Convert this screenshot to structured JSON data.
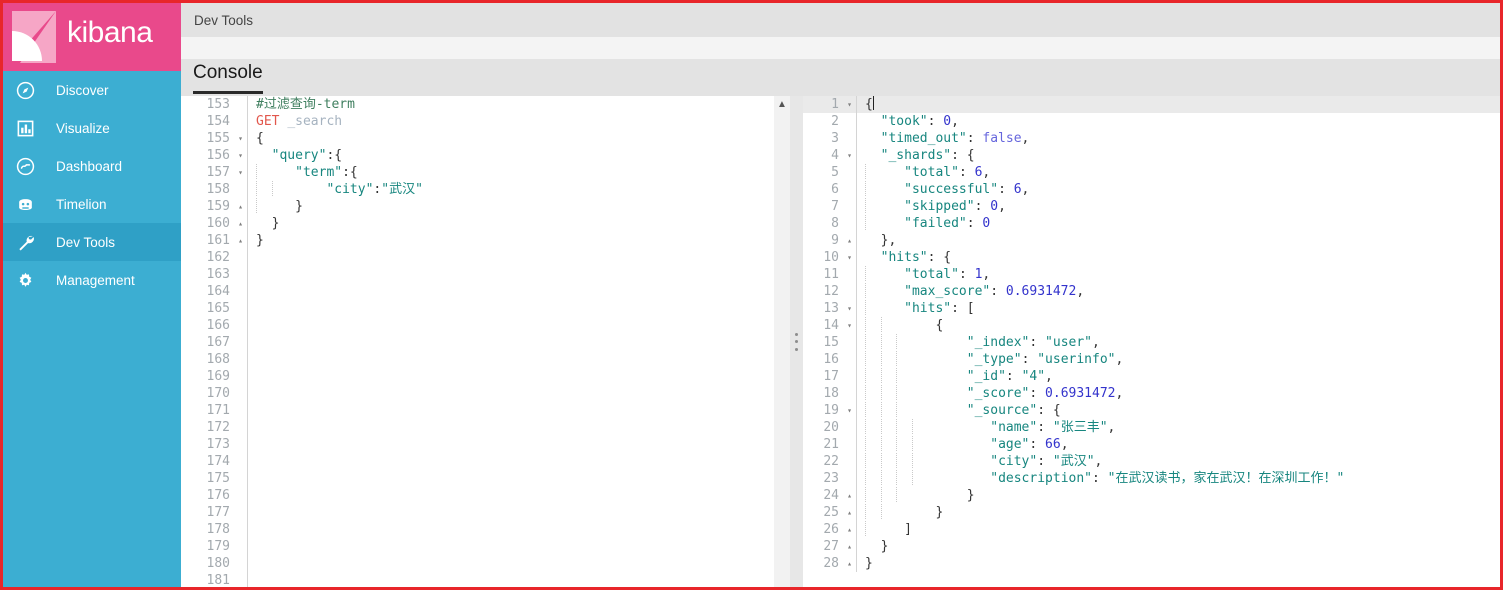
{
  "app": {
    "name": "kibana",
    "brand_color": "#e9498b",
    "sidebar_color": "#3caed2",
    "sidebar_active_color": "#2fa0c6",
    "frame_border_color": "#e8262a"
  },
  "sidebar": {
    "logo_label": "kibana",
    "items": [
      {
        "label": "Discover",
        "icon": "compass-icon",
        "active": false
      },
      {
        "label": "Visualize",
        "icon": "bar-chart-icon",
        "active": false
      },
      {
        "label": "Dashboard",
        "icon": "dashboard-icon",
        "active": false
      },
      {
        "label": "Timelion",
        "icon": "timelion-icon",
        "active": false
      },
      {
        "label": "Dev Tools",
        "icon": "wrench-icon",
        "active": true
      },
      {
        "label": "Management",
        "icon": "gear-icon",
        "active": false
      }
    ]
  },
  "header": {
    "breadcrumb": "Dev Tools"
  },
  "tabs": {
    "console_label": "Console"
  },
  "editor": {
    "scroll_up_icon": "chevron-up-icon",
    "first_line_number": 153,
    "lines": [
      {
        "n": 153,
        "fold": "",
        "tokens": [
          {
            "t": "comment",
            "v": "#过滤查询-term"
          }
        ]
      },
      {
        "n": 154,
        "fold": "",
        "tokens": [
          {
            "t": "method",
            "v": "GET"
          },
          {
            "t": "punc",
            "v": " "
          },
          {
            "t": "url",
            "v": "_search"
          }
        ]
      },
      {
        "n": 155,
        "fold": "▾",
        "tokens": [
          {
            "t": "punc",
            "v": "{"
          }
        ]
      },
      {
        "n": 156,
        "fold": "▾",
        "tokens": [
          {
            "t": "punc",
            "v": "  "
          },
          {
            "t": "key",
            "v": "\"query\""
          },
          {
            "t": "punc",
            "v": ":{"
          }
        ]
      },
      {
        "n": 157,
        "fold": "▾",
        "tokens": [
          {
            "t": "guide",
            "v": ""
          },
          {
            "t": "punc",
            "v": "   "
          },
          {
            "t": "key",
            "v": "\"term\""
          },
          {
            "t": "punc",
            "v": ":{"
          }
        ]
      },
      {
        "n": 158,
        "fold": "",
        "tokens": [
          {
            "t": "guide",
            "v": ""
          },
          {
            "t": "guide",
            "v": ""
          },
          {
            "t": "punc",
            "v": "     "
          },
          {
            "t": "key",
            "v": "\"city\""
          },
          {
            "t": "punc",
            "v": ":"
          },
          {
            "t": "str",
            "v": "\"武汉\""
          }
        ]
      },
      {
        "n": 159,
        "fold": "▴",
        "tokens": [
          {
            "t": "guide",
            "v": ""
          },
          {
            "t": "punc",
            "v": "   }"
          }
        ]
      },
      {
        "n": 160,
        "fold": "▴",
        "tokens": [
          {
            "t": "punc",
            "v": "  }"
          }
        ]
      },
      {
        "n": 161,
        "fold": "▴",
        "tokens": [
          {
            "t": "punc",
            "v": "}"
          }
        ]
      },
      {
        "n": 162,
        "fold": "",
        "tokens": []
      },
      {
        "n": 163,
        "fold": "",
        "tokens": []
      },
      {
        "n": 164,
        "fold": "",
        "tokens": []
      },
      {
        "n": 165,
        "fold": "",
        "tokens": []
      },
      {
        "n": 166,
        "fold": "",
        "tokens": []
      },
      {
        "n": 167,
        "fold": "",
        "tokens": []
      },
      {
        "n": 168,
        "fold": "",
        "tokens": []
      },
      {
        "n": 169,
        "fold": "",
        "tokens": []
      },
      {
        "n": 170,
        "fold": "",
        "tokens": []
      },
      {
        "n": 171,
        "fold": "",
        "tokens": []
      },
      {
        "n": 172,
        "fold": "",
        "tokens": []
      },
      {
        "n": 173,
        "fold": "",
        "tokens": []
      },
      {
        "n": 174,
        "fold": "",
        "tokens": []
      },
      {
        "n": 175,
        "fold": "",
        "tokens": []
      },
      {
        "n": 176,
        "fold": "",
        "tokens": []
      },
      {
        "n": 177,
        "fold": "",
        "tokens": []
      },
      {
        "n": 178,
        "fold": "",
        "tokens": []
      },
      {
        "n": 179,
        "fold": "",
        "tokens": []
      },
      {
        "n": 180,
        "fold": "",
        "tokens": []
      },
      {
        "n": 181,
        "fold": "",
        "tokens": []
      }
    ]
  },
  "response": {
    "lines": [
      {
        "n": 1,
        "fold": "▾",
        "active": true,
        "tokens": [
          {
            "t": "punc",
            "v": "{"
          },
          {
            "t": "cursor",
            "v": ""
          }
        ]
      },
      {
        "n": 2,
        "fold": "",
        "tokens": [
          {
            "t": "punc",
            "v": "  "
          },
          {
            "t": "key",
            "v": "\"took\""
          },
          {
            "t": "punc",
            "v": ": "
          },
          {
            "t": "num",
            "v": "0"
          },
          {
            "t": "punc",
            "v": ","
          }
        ]
      },
      {
        "n": 3,
        "fold": "",
        "tokens": [
          {
            "t": "punc",
            "v": "  "
          },
          {
            "t": "key",
            "v": "\"timed_out\""
          },
          {
            "t": "punc",
            "v": ": "
          },
          {
            "t": "bool",
            "v": "false"
          },
          {
            "t": "punc",
            "v": ","
          }
        ]
      },
      {
        "n": 4,
        "fold": "▾",
        "tokens": [
          {
            "t": "punc",
            "v": "  "
          },
          {
            "t": "key",
            "v": "\"_shards\""
          },
          {
            "t": "punc",
            "v": ": {"
          }
        ]
      },
      {
        "n": 5,
        "fold": "",
        "tokens": [
          {
            "t": "guide",
            "v": ""
          },
          {
            "t": "punc",
            "v": "   "
          },
          {
            "t": "key",
            "v": "\"total\""
          },
          {
            "t": "punc",
            "v": ": "
          },
          {
            "t": "num",
            "v": "6"
          },
          {
            "t": "punc",
            "v": ","
          }
        ]
      },
      {
        "n": 6,
        "fold": "",
        "tokens": [
          {
            "t": "guide",
            "v": ""
          },
          {
            "t": "punc",
            "v": "   "
          },
          {
            "t": "key",
            "v": "\"successful\""
          },
          {
            "t": "punc",
            "v": ": "
          },
          {
            "t": "num",
            "v": "6"
          },
          {
            "t": "punc",
            "v": ","
          }
        ]
      },
      {
        "n": 7,
        "fold": "",
        "tokens": [
          {
            "t": "guide",
            "v": ""
          },
          {
            "t": "punc",
            "v": "   "
          },
          {
            "t": "key",
            "v": "\"skipped\""
          },
          {
            "t": "punc",
            "v": ": "
          },
          {
            "t": "num",
            "v": "0"
          },
          {
            "t": "punc",
            "v": ","
          }
        ]
      },
      {
        "n": 8,
        "fold": "",
        "tokens": [
          {
            "t": "guide",
            "v": ""
          },
          {
            "t": "punc",
            "v": "   "
          },
          {
            "t": "key",
            "v": "\"failed\""
          },
          {
            "t": "punc",
            "v": ": "
          },
          {
            "t": "num",
            "v": "0"
          }
        ]
      },
      {
        "n": 9,
        "fold": "▴",
        "tokens": [
          {
            "t": "punc",
            "v": "  },"
          }
        ]
      },
      {
        "n": 10,
        "fold": "▾",
        "tokens": [
          {
            "t": "punc",
            "v": "  "
          },
          {
            "t": "key",
            "v": "\"hits\""
          },
          {
            "t": "punc",
            "v": ": {"
          }
        ]
      },
      {
        "n": 11,
        "fold": "",
        "tokens": [
          {
            "t": "guide",
            "v": ""
          },
          {
            "t": "punc",
            "v": "   "
          },
          {
            "t": "key",
            "v": "\"total\""
          },
          {
            "t": "punc",
            "v": ": "
          },
          {
            "t": "num",
            "v": "1"
          },
          {
            "t": "punc",
            "v": ","
          }
        ]
      },
      {
        "n": 12,
        "fold": "",
        "tokens": [
          {
            "t": "guide",
            "v": ""
          },
          {
            "t": "punc",
            "v": "   "
          },
          {
            "t": "key",
            "v": "\"max_score\""
          },
          {
            "t": "punc",
            "v": ": "
          },
          {
            "t": "num",
            "v": "0.6931472"
          },
          {
            "t": "punc",
            "v": ","
          }
        ]
      },
      {
        "n": 13,
        "fold": "▾",
        "tokens": [
          {
            "t": "guide",
            "v": ""
          },
          {
            "t": "punc",
            "v": "   "
          },
          {
            "t": "key",
            "v": "\"hits\""
          },
          {
            "t": "punc",
            "v": ": ["
          }
        ]
      },
      {
        "n": 14,
        "fold": "▾",
        "tokens": [
          {
            "t": "guide",
            "v": ""
          },
          {
            "t": "guide",
            "v": ""
          },
          {
            "t": "punc",
            "v": "     {"
          }
        ]
      },
      {
        "n": 15,
        "fold": "",
        "tokens": [
          {
            "t": "guide",
            "v": ""
          },
          {
            "t": "guide",
            "v": ""
          },
          {
            "t": "guide",
            "v": ""
          },
          {
            "t": "punc",
            "v": "       "
          },
          {
            "t": "key",
            "v": "\"_index\""
          },
          {
            "t": "punc",
            "v": ": "
          },
          {
            "t": "str",
            "v": "\"user\""
          },
          {
            "t": "punc",
            "v": ","
          }
        ]
      },
      {
        "n": 16,
        "fold": "",
        "tokens": [
          {
            "t": "guide",
            "v": ""
          },
          {
            "t": "guide",
            "v": ""
          },
          {
            "t": "guide",
            "v": ""
          },
          {
            "t": "punc",
            "v": "       "
          },
          {
            "t": "key",
            "v": "\"_type\""
          },
          {
            "t": "punc",
            "v": ": "
          },
          {
            "t": "str",
            "v": "\"userinfo\""
          },
          {
            "t": "punc",
            "v": ","
          }
        ]
      },
      {
        "n": 17,
        "fold": "",
        "tokens": [
          {
            "t": "guide",
            "v": ""
          },
          {
            "t": "guide",
            "v": ""
          },
          {
            "t": "guide",
            "v": ""
          },
          {
            "t": "punc",
            "v": "       "
          },
          {
            "t": "key",
            "v": "\"_id\""
          },
          {
            "t": "punc",
            "v": ": "
          },
          {
            "t": "str",
            "v": "\"4\""
          },
          {
            "t": "punc",
            "v": ","
          }
        ]
      },
      {
        "n": 18,
        "fold": "",
        "tokens": [
          {
            "t": "guide",
            "v": ""
          },
          {
            "t": "guide",
            "v": ""
          },
          {
            "t": "guide",
            "v": ""
          },
          {
            "t": "punc",
            "v": "       "
          },
          {
            "t": "key",
            "v": "\"_score\""
          },
          {
            "t": "punc",
            "v": ": "
          },
          {
            "t": "num",
            "v": "0.6931472"
          },
          {
            "t": "punc",
            "v": ","
          }
        ]
      },
      {
        "n": 19,
        "fold": "▾",
        "tokens": [
          {
            "t": "guide",
            "v": ""
          },
          {
            "t": "guide",
            "v": ""
          },
          {
            "t": "guide",
            "v": ""
          },
          {
            "t": "punc",
            "v": "       "
          },
          {
            "t": "key",
            "v": "\"_source\""
          },
          {
            "t": "punc",
            "v": ": {"
          }
        ]
      },
      {
        "n": 20,
        "fold": "",
        "tokens": [
          {
            "t": "guide",
            "v": ""
          },
          {
            "t": "guide",
            "v": ""
          },
          {
            "t": "guide",
            "v": ""
          },
          {
            "t": "guide",
            "v": ""
          },
          {
            "t": "punc",
            "v": "        "
          },
          {
            "t": "key",
            "v": "\"name\""
          },
          {
            "t": "punc",
            "v": ": "
          },
          {
            "t": "str",
            "v": "\"张三丰\""
          },
          {
            "t": "punc",
            "v": ","
          }
        ]
      },
      {
        "n": 21,
        "fold": "",
        "tokens": [
          {
            "t": "guide",
            "v": ""
          },
          {
            "t": "guide",
            "v": ""
          },
          {
            "t": "guide",
            "v": ""
          },
          {
            "t": "guide",
            "v": ""
          },
          {
            "t": "punc",
            "v": "        "
          },
          {
            "t": "key",
            "v": "\"age\""
          },
          {
            "t": "punc",
            "v": ": "
          },
          {
            "t": "num",
            "v": "66"
          },
          {
            "t": "punc",
            "v": ","
          }
        ]
      },
      {
        "n": 22,
        "fold": "",
        "tokens": [
          {
            "t": "guide",
            "v": ""
          },
          {
            "t": "guide",
            "v": ""
          },
          {
            "t": "guide",
            "v": ""
          },
          {
            "t": "guide",
            "v": ""
          },
          {
            "t": "punc",
            "v": "        "
          },
          {
            "t": "key",
            "v": "\"city\""
          },
          {
            "t": "punc",
            "v": ": "
          },
          {
            "t": "str",
            "v": "\"武汉\""
          },
          {
            "t": "punc",
            "v": ","
          }
        ]
      },
      {
        "n": 23,
        "fold": "",
        "tokens": [
          {
            "t": "guide",
            "v": ""
          },
          {
            "t": "guide",
            "v": ""
          },
          {
            "t": "guide",
            "v": ""
          },
          {
            "t": "guide",
            "v": ""
          },
          {
            "t": "punc",
            "v": "        "
          },
          {
            "t": "key",
            "v": "\"description\""
          },
          {
            "t": "punc",
            "v": ": "
          },
          {
            "t": "str",
            "v": "\"在武汉读书，家在武汉！在深圳工作！\""
          }
        ]
      },
      {
        "n": 24,
        "fold": "▴",
        "tokens": [
          {
            "t": "guide",
            "v": ""
          },
          {
            "t": "guide",
            "v": ""
          },
          {
            "t": "guide",
            "v": ""
          },
          {
            "t": "punc",
            "v": "       }"
          }
        ]
      },
      {
        "n": 25,
        "fold": "▴",
        "tokens": [
          {
            "t": "guide",
            "v": ""
          },
          {
            "t": "guide",
            "v": ""
          },
          {
            "t": "punc",
            "v": "     }"
          }
        ]
      },
      {
        "n": 26,
        "fold": "▴",
        "tokens": [
          {
            "t": "guide",
            "v": ""
          },
          {
            "t": "punc",
            "v": "   ]"
          }
        ]
      },
      {
        "n": 27,
        "fold": "▴",
        "tokens": [
          {
            "t": "punc",
            "v": "  }"
          }
        ]
      },
      {
        "n": 28,
        "fold": "▴",
        "tokens": [
          {
            "t": "punc",
            "v": "}"
          }
        ]
      }
    ]
  },
  "splitter": {
    "grip_icon": "drag-handle-icon"
  }
}
